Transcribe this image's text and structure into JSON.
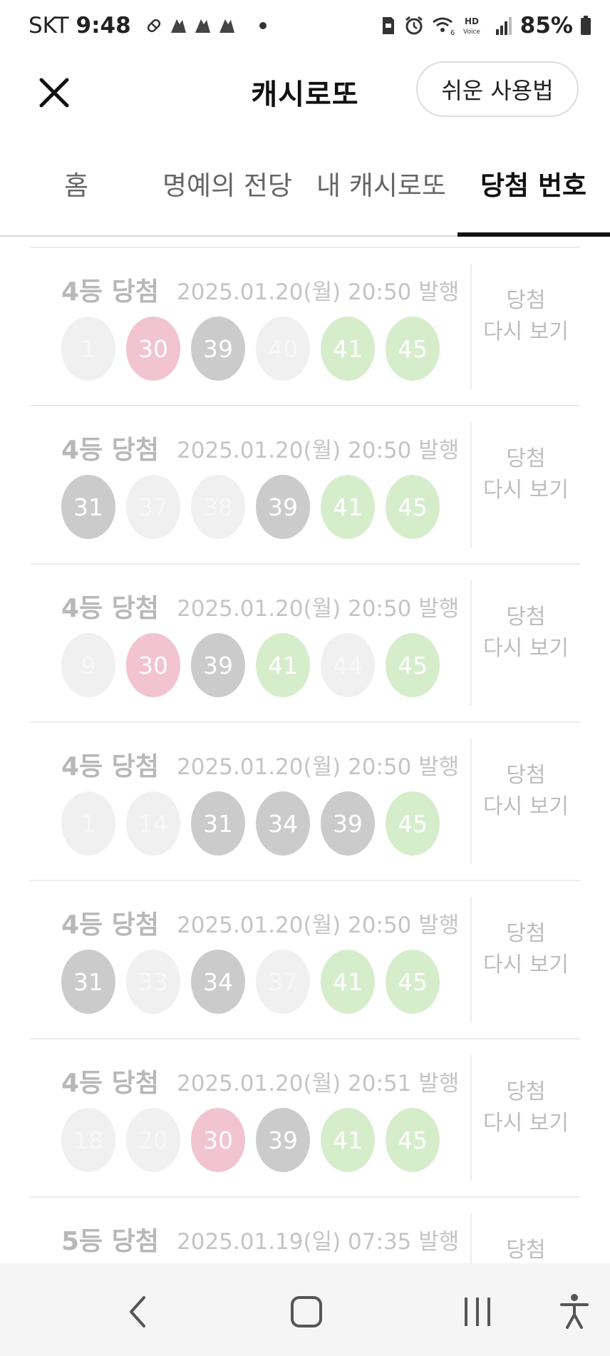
{
  "status_bar": {
    "carrier": "SKT",
    "time": "9:48",
    "battery": "85%"
  },
  "header": {
    "title": "캐시로또",
    "guide_button": "쉬운 사용법"
  },
  "tabs": [
    {
      "label": "홈"
    },
    {
      "label": "명예의 전당"
    },
    {
      "label": "내 캐시로또"
    },
    {
      "label": "당첨 번호"
    }
  ],
  "entries": [
    {
      "rank": "4등 당첨",
      "date": "2025.01.20(월) 20:50 발행",
      "balls": [
        {
          "n": "1",
          "c": "light"
        },
        {
          "n": "30",
          "c": "pink"
        },
        {
          "n": "39",
          "c": "gray"
        },
        {
          "n": "40",
          "c": "light"
        },
        {
          "n": "41",
          "c": "green"
        },
        {
          "n": "45",
          "c": "green"
        }
      ]
    },
    {
      "rank": "4등 당첨",
      "date": "2025.01.20(월) 20:50 발행",
      "balls": [
        {
          "n": "31",
          "c": "gray"
        },
        {
          "n": "37",
          "c": "light"
        },
        {
          "n": "38",
          "c": "light"
        },
        {
          "n": "39",
          "c": "gray"
        },
        {
          "n": "41",
          "c": "green"
        },
        {
          "n": "45",
          "c": "green"
        }
      ]
    },
    {
      "rank": "4등 당첨",
      "date": "2025.01.20(월) 20:50 발행",
      "balls": [
        {
          "n": "9",
          "c": "light"
        },
        {
          "n": "30",
          "c": "pink"
        },
        {
          "n": "39",
          "c": "gray"
        },
        {
          "n": "41",
          "c": "green"
        },
        {
          "n": "44",
          "c": "light"
        },
        {
          "n": "45",
          "c": "green"
        }
      ]
    },
    {
      "rank": "4등 당첨",
      "date": "2025.01.20(월) 20:50 발행",
      "balls": [
        {
          "n": "1",
          "c": "light"
        },
        {
          "n": "14",
          "c": "light"
        },
        {
          "n": "31",
          "c": "gray"
        },
        {
          "n": "34",
          "c": "gray"
        },
        {
          "n": "39",
          "c": "gray"
        },
        {
          "n": "45",
          "c": "green"
        }
      ]
    },
    {
      "rank": "4등 당첨",
      "date": "2025.01.20(월) 20:50 발행",
      "balls": [
        {
          "n": "31",
          "c": "gray"
        },
        {
          "n": "33",
          "c": "light"
        },
        {
          "n": "34",
          "c": "gray"
        },
        {
          "n": "37",
          "c": "light"
        },
        {
          "n": "41",
          "c": "green"
        },
        {
          "n": "45",
          "c": "green"
        }
      ]
    },
    {
      "rank": "4등 당첨",
      "date": "2025.01.20(월) 20:51 발행",
      "balls": [
        {
          "n": "18",
          "c": "light"
        },
        {
          "n": "20",
          "c": "light"
        },
        {
          "n": "30",
          "c": "pink"
        },
        {
          "n": "39",
          "c": "gray"
        },
        {
          "n": "41",
          "c": "green"
        },
        {
          "n": "45",
          "c": "green"
        }
      ]
    },
    {
      "rank": "5등 당첨",
      "date": "2025.01.19(일) 07:35 발행",
      "balls": []
    }
  ],
  "action_label_line1": "당첨",
  "action_label_line2": "다시 보기"
}
